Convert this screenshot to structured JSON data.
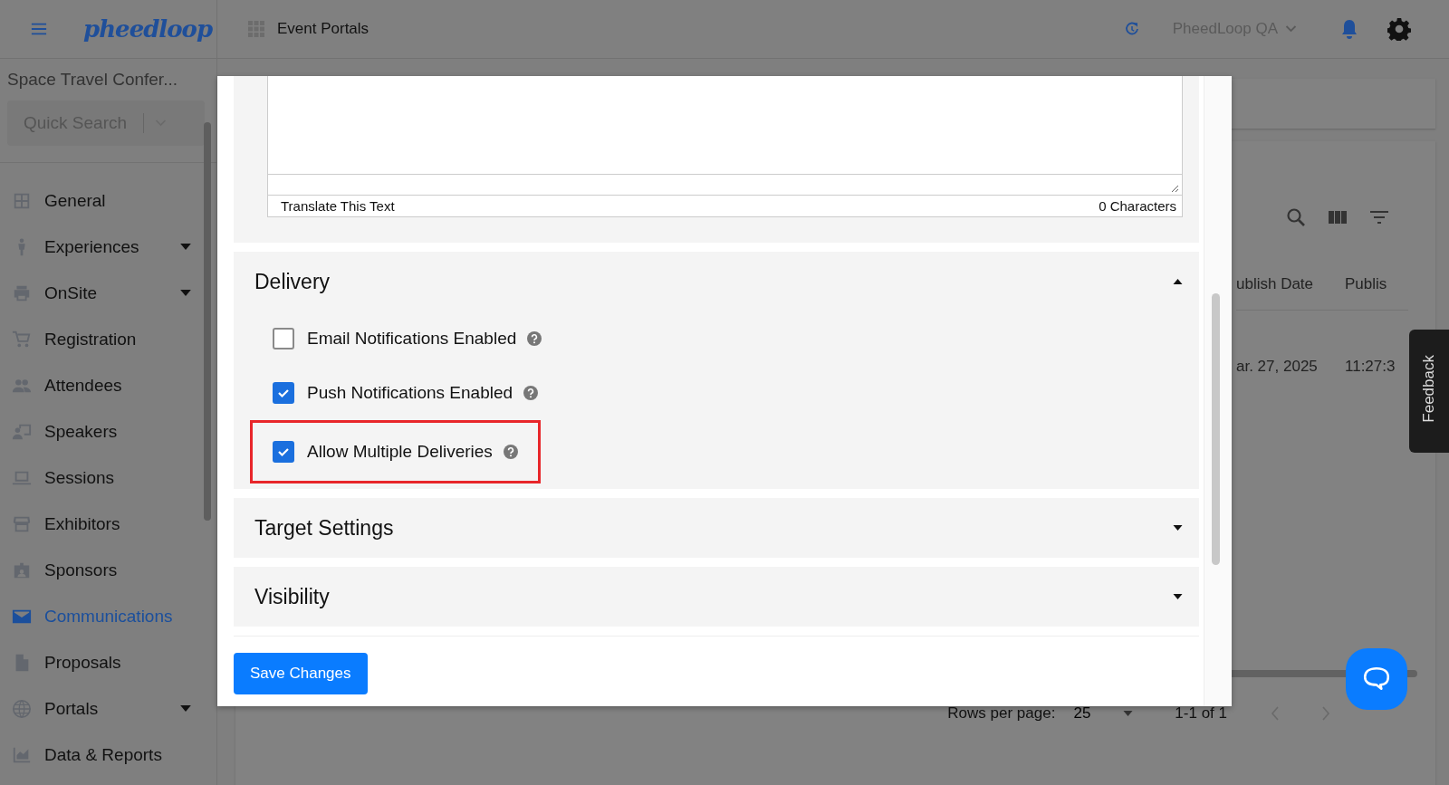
{
  "topbar": {
    "logo": "pheedloop",
    "app_title": "Event Portals",
    "account": "PheedLoop QA"
  },
  "sidebar": {
    "event_name": "Space Travel Confer...",
    "search": {
      "placeholder": "Quick Search"
    },
    "items": [
      {
        "label": "General",
        "selected": false,
        "has_submenu": false
      },
      {
        "label": "Experiences",
        "selected": false,
        "has_submenu": true
      },
      {
        "label": "OnSite",
        "selected": false,
        "has_submenu": true
      },
      {
        "label": "Registration",
        "selected": false,
        "has_submenu": false
      },
      {
        "label": "Attendees",
        "selected": false,
        "has_submenu": false
      },
      {
        "label": "Speakers",
        "selected": false,
        "has_submenu": false
      },
      {
        "label": "Sessions",
        "selected": false,
        "has_submenu": false
      },
      {
        "label": "Exhibitors",
        "selected": false,
        "has_submenu": false
      },
      {
        "label": "Sponsors",
        "selected": false,
        "has_submenu": false
      },
      {
        "label": "Communications",
        "selected": true,
        "has_submenu": false
      },
      {
        "label": "Proposals",
        "selected": false,
        "has_submenu": false
      },
      {
        "label": "Portals",
        "selected": false,
        "has_submenu": true
      },
      {
        "label": "Data & Reports",
        "selected": false,
        "has_submenu": false
      }
    ]
  },
  "table": {
    "columns": [
      "ublish Date",
      "Publis"
    ],
    "rows": [
      [
        "ar. 27, 2025",
        "11:27:3"
      ]
    ],
    "pagination": {
      "rows_label": "Rows per page:",
      "rows_value": "25",
      "range": "1-1 of 1"
    }
  },
  "feedback_tab": "Feedback",
  "modal": {
    "textarea_footer": {
      "translate_link": "Translate This Text",
      "count": "0 Characters"
    },
    "sections": [
      {
        "title": "Delivery",
        "expanded": true,
        "options": [
          {
            "label": "Email Notifications Enabled",
            "checked": false,
            "highlighted": false
          },
          {
            "label": "Push Notifications Enabled",
            "checked": true,
            "highlighted": false
          },
          {
            "label": "Allow Multiple Deliveries",
            "checked": true,
            "highlighted": true
          }
        ]
      },
      {
        "title": "Target Settings",
        "expanded": false
      },
      {
        "title": "Visibility",
        "expanded": false
      }
    ],
    "save_button": "Save Changes"
  }
}
